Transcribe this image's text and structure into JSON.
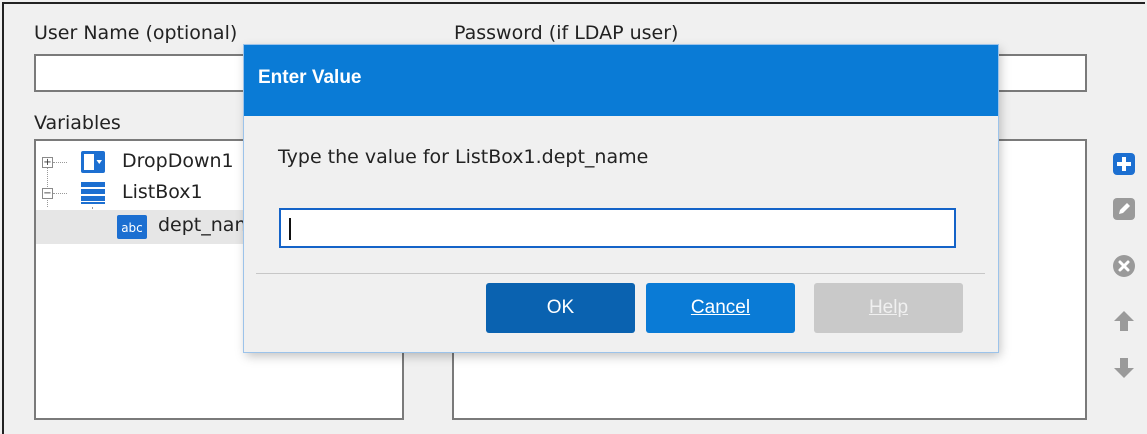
{
  "form": {
    "username_label": "User Name (optional)",
    "username_value": "",
    "password_label": "Password (if LDAP user)",
    "password_value": "",
    "variables_label": "Variables"
  },
  "tree": {
    "items": [
      {
        "label": "DropDown1",
        "icon": "dropdown-icon",
        "expander": "+"
      },
      {
        "label": "ListBox1",
        "icon": "listbox-icon",
        "expander": "−"
      },
      {
        "label": "dept_name",
        "icon": "abc-text-icon"
      }
    ]
  },
  "side_actions": [
    {
      "name": "add-icon"
    },
    {
      "name": "edit-icon"
    },
    {
      "name": "delete-icon"
    },
    {
      "name": "move-up-icon"
    },
    {
      "name": "move-down-icon"
    }
  ],
  "dialog": {
    "title": "Enter Value",
    "prompt": "Type the value for ListBox1.dept_name",
    "input_value": "",
    "ok_label": "OK",
    "cancel_label": "Cancel",
    "help_label": "Help"
  },
  "colors": {
    "accent": "#0a7bd6",
    "ok_button": "#0a62b0",
    "disabled_button": "#c9c9c9",
    "icon_blue": "#1c6fd1",
    "icon_gray": "#9a9a9a"
  }
}
